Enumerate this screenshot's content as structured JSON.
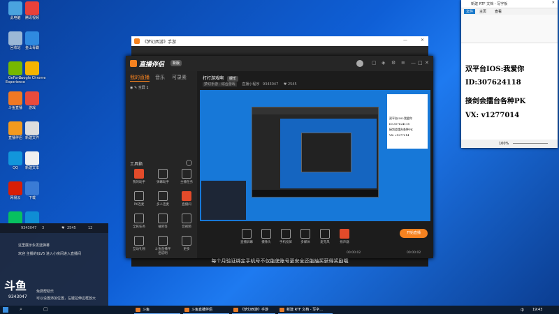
{
  "desktop": {
    "icons": [
      {
        "label": "此电脑",
        "color": "#4aa3df"
      },
      {
        "label": "腾讯视频",
        "color": "#e9413a"
      },
      {
        "label": "回收站",
        "color": "#9bb8d6"
      },
      {
        "label": "金山毒霸",
        "color": "#2f8ae0"
      },
      {
        "label": "GeForce Experience",
        "color": "#76b900"
      },
      {
        "label": "Google Chrome",
        "color": "#f4b400"
      },
      {
        "label": "斗鱼直播",
        "color": "#f07823"
      },
      {
        "label": "游戏",
        "color": "#e94b3c"
      },
      {
        "label": "直播伴侣",
        "color": "#f39a1e"
      },
      {
        "label": "新建文件",
        "color": "#dddddd"
      },
      {
        "label": "QQ",
        "color": "#1296db"
      },
      {
        "label": "新建文本",
        "color": "#f0f0f0"
      },
      {
        "label": "网易云",
        "color": "#d81e06"
      },
      {
        "label": "下载",
        "color": "#3a7bd5"
      },
      {
        "label": "微信",
        "color": "#07c160"
      },
      {
        "label": "Edge",
        "color": "#0f8dd4"
      }
    ]
  },
  "game_window": {
    "title": "《梦幻西游》手游",
    "bottom_text": "每个月验证绑定手机号不仅能使账号更安全还能抽奖获得奖励哦"
  },
  "live_app": {
    "logo": "直播伴侣",
    "logo_badge": "新版",
    "tabs": [
      "我的直播",
      "音乐",
      "可录素"
    ],
    "scene": "全屏 1",
    "room_title": "打打游戏啊",
    "room_tag": "娱乐",
    "category": "梦幻手游 · 综合游戏",
    "room_id_label": "直播小程序",
    "room_id": "9343047",
    "fans_count": "2545",
    "tools_header": "工具箱",
    "tools": [
      {
        "label": "我的助手",
        "red": true
      },
      {
        "label": "弹幕助手",
        "red": false
      },
      {
        "label": "主播任务",
        "red": false
      },
      {
        "label": "PK连麦",
        "red": false
      },
      {
        "label": "多人连麦",
        "red": false
      },
      {
        "label": "直播间",
        "red": true
      },
      {
        "label": "全民任务",
        "red": false
      },
      {
        "label": "抽奖等",
        "red": false
      },
      {
        "label": "音视频",
        "red": false
      },
      {
        "label": "互动礼物",
        "red": false
      },
      {
        "label": "斗鱼直播伴侣说明",
        "red": false
      },
      {
        "label": "更多",
        "red": false
      }
    ],
    "controls": [
      "直播屏幕",
      "摄像头",
      "手机投屏",
      "多媒体",
      "麦克风",
      "扬声器"
    ],
    "start_button": "开始直播",
    "time_left": "00:00:02",
    "time_right": "00:00:02"
  },
  "wordpad": {
    "title": "新建 RTF 文档 - 写字板",
    "ribbon_tabs": [
      "文件",
      "主页",
      "查看"
    ],
    "lines": [
      "双平台IOS:我爱你",
      "ID:307624118",
      "接剑会擂台各种PK",
      "VX: v1277014"
    ],
    "zoom": "100%"
  },
  "chat": {
    "header_left": "9343047",
    "header_mid": "3",
    "header_count": "2545",
    "header_right": "12",
    "lines": [
      "这里展示永发送弹幕",
      "欢迎 主播的IJLV5 进入小房间进入直播间",
      "免费帮助乐",
      "可以设置添加位置，左键拉伸边框放大"
    ],
    "overlay_text": "斗鱼",
    "overlay_id": "9343047"
  },
  "taskbar": {
    "items": [
      "斗鱼",
      "斗鱼直播伴侣",
      "《梦幻西游》手游",
      "新建 RTF 文档 - 写字..."
    ],
    "time": "19:43",
    "lang": "中"
  }
}
